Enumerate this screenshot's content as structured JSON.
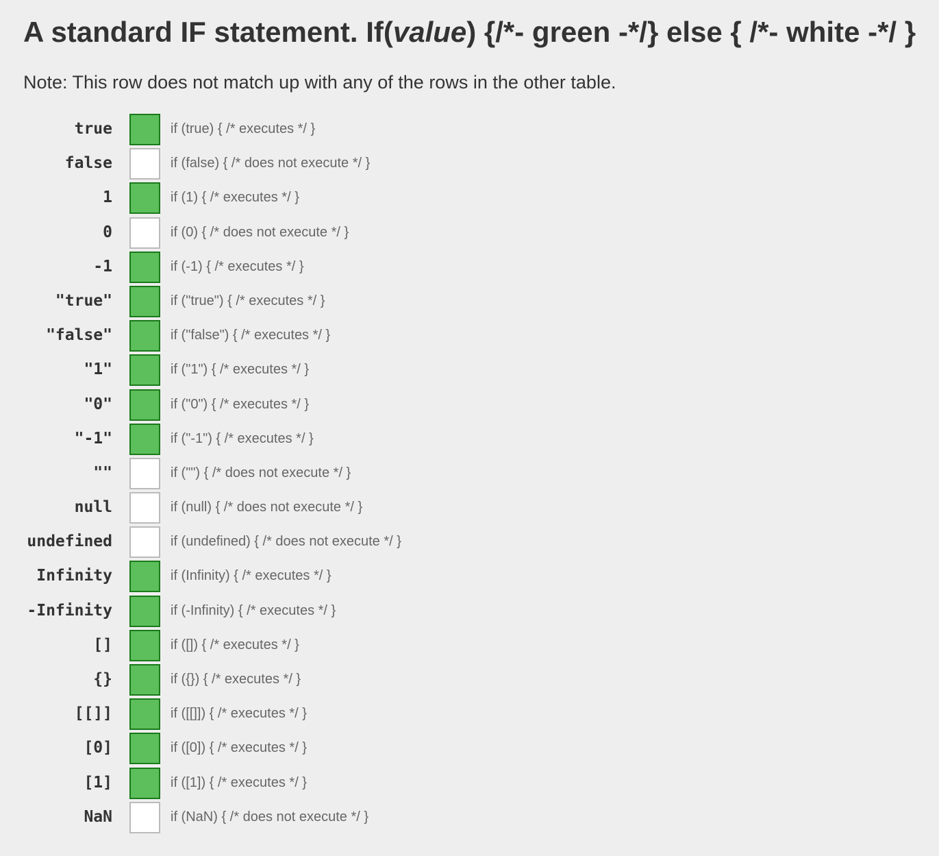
{
  "heading": {
    "prefix": "A standard IF statement. If(",
    "emphasis": "value",
    "suffix": ") {/*- green -*/} else { /*- white -*/ }"
  },
  "note": "Note: This row does not match up with any of the rows in the other table.",
  "colors": {
    "executes": "#5cbf5c",
    "executes_border": "#1a7a1a",
    "not_executes": "#ffffff",
    "not_executes_border": "#bbbbbb"
  },
  "rows": [
    {
      "label": "true",
      "executes": true,
      "code": "if (true) { /* executes */ }"
    },
    {
      "label": "false",
      "executes": false,
      "code": "if (false) { /* does not execute */ }"
    },
    {
      "label": "1",
      "executes": true,
      "code": "if (1) { /* executes */ }"
    },
    {
      "label": "0",
      "executes": false,
      "code": "if (0) { /* does not execute */ }"
    },
    {
      "label": "-1",
      "executes": true,
      "code": "if (-1) { /* executes */ }"
    },
    {
      "label": "\"true\"",
      "executes": true,
      "code": "if (\"true\") { /* executes */ }"
    },
    {
      "label": "\"false\"",
      "executes": true,
      "code": "if (\"false\") { /* executes */ }"
    },
    {
      "label": "\"1\"",
      "executes": true,
      "code": "if (\"1\") { /* executes */ }"
    },
    {
      "label": "\"0\"",
      "executes": true,
      "code": "if (\"0\") { /* executes */ }"
    },
    {
      "label": "\"-1\"",
      "executes": true,
      "code": "if (\"-1\") { /* executes */ }"
    },
    {
      "label": "\"\"",
      "executes": false,
      "code": "if (\"\") { /* does not execute */ }"
    },
    {
      "label": "null",
      "executes": false,
      "code": "if (null) { /* does not execute */ }"
    },
    {
      "label": "undefined",
      "executes": false,
      "code": "if (undefined) { /* does not execute */ }"
    },
    {
      "label": "Infinity",
      "executes": true,
      "code": "if (Infinity) { /* executes */ }"
    },
    {
      "label": "-Infinity",
      "executes": true,
      "code": "if (-Infinity) { /* executes */ }"
    },
    {
      "label": "[]",
      "executes": true,
      "code": "if ([]) { /* executes */ }"
    },
    {
      "label": "{}",
      "executes": true,
      "code": "if ({}) { /* executes */ }"
    },
    {
      "label": "[[]]",
      "executes": true,
      "code": "if ([[]]) { /* executes */ }"
    },
    {
      "label": "[0]",
      "executes": true,
      "code": "if ([0]) { /* executes */ }"
    },
    {
      "label": "[1]",
      "executes": true,
      "code": "if ([1]) { /* executes */ }"
    },
    {
      "label": "NaN",
      "executes": false,
      "code": "if (NaN) { /* does not execute */ }"
    }
  ]
}
